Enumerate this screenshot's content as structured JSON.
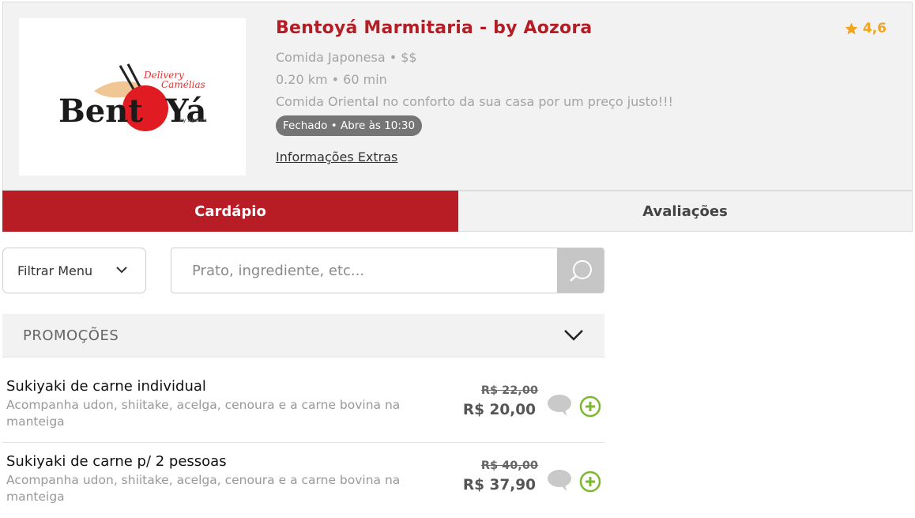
{
  "store": {
    "name": "Bentoyá Marmitaria - by Aozora",
    "rating": "4,6",
    "category": "Comida Japonesa • $$",
    "distance_time": "0.20 km • 60 min",
    "description": "Comida Oriental no conforto da sua casa por um preço justo!!!",
    "status": "Fechado • Abre às 10:30",
    "extra_info_link": "Informações Extras",
    "logo": {
      "top_text": "Delivery",
      "sub_text": "Camélias",
      "main_text_left": "Bent",
      "main_text_right": "Yá",
      "by_text": "by Aozora",
      "accent_color": "#e01b22"
    }
  },
  "tabs": [
    {
      "label": "Cardápio",
      "active": true
    },
    {
      "label": "Avaliações",
      "active": false
    }
  ],
  "filter": {
    "label": "Filtrar Menu"
  },
  "search": {
    "placeholder": "Prato, ingrediente, etc..."
  },
  "section": {
    "title": "PROMOÇÕES"
  },
  "items": [
    {
      "name": "Sukiyaki de carne individual",
      "description": "Acompanha udon, shiitake, acelga, cenoura e a carne bovina na manteiga",
      "old_price": "R$ 22,00",
      "price": "R$ 20,00"
    },
    {
      "name": "Sukiyaki de carne p/ 2 pessoas",
      "description": "Acompanha udon, shiitake, acelga, cenoura e a carne bovina na manteiga",
      "old_price": "R$ 40,00",
      "price": "R$ 37,90"
    }
  ],
  "colors": {
    "brand_red": "#b81d25",
    "rating_gold": "#f0a521",
    "add_green": "#7cb82f"
  }
}
